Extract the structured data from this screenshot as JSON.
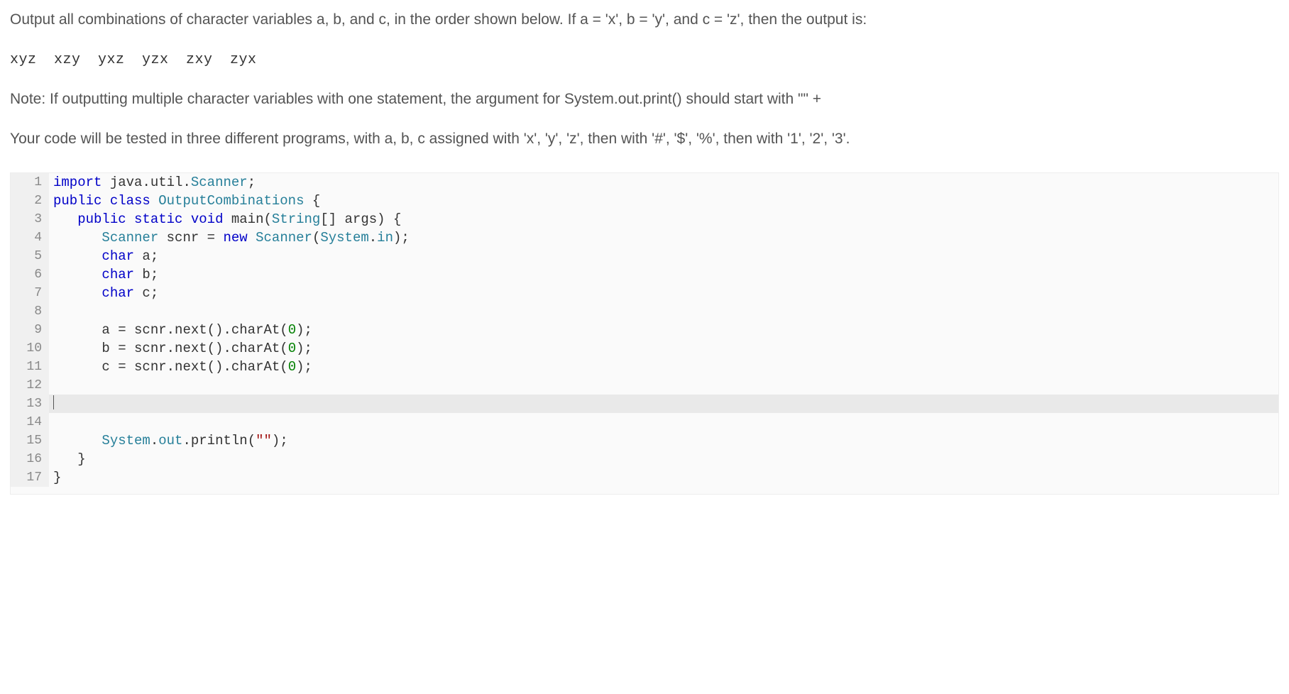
{
  "prompt": {
    "p1": "Output all combinations of character variables a, b, and c, in the order shown below. If a = 'x', b = 'y', and c = 'z', then the output is:",
    "sample": "xyz xzy yxz yzx zxy zyx",
    "p2": "Note: If outputting multiple character variables with one statement, the argument for System.out.print() should start with \"\" +",
    "p3": "Your code will be tested in three different programs, with a, b, c assigned with 'x', 'y', 'z', then with '#', '$', '%', then with '1', '2', '3'."
  },
  "code": {
    "lines": [
      {
        "n": 1,
        "tokens": [
          [
            "kw",
            "import"
          ],
          [
            "",
            " java"
          ],
          [
            "op",
            "."
          ],
          [
            "",
            "util"
          ],
          [
            "op",
            "."
          ],
          [
            "type",
            "Scanner"
          ],
          [
            "op",
            ";"
          ]
        ]
      },
      {
        "n": 2,
        "tokens": [
          [
            "kw",
            "public class"
          ],
          [
            "",
            " "
          ],
          [
            "type",
            "OutputCombinations"
          ],
          [
            "",
            " "
          ],
          [
            "op",
            "{"
          ]
        ]
      },
      {
        "n": 3,
        "tokens": [
          [
            "",
            "   "
          ],
          [
            "kw",
            "public static"
          ],
          [
            "",
            " "
          ],
          [
            "kw",
            "void"
          ],
          [
            "",
            " "
          ],
          [
            "",
            "main"
          ],
          [
            "op",
            "("
          ],
          [
            "type",
            "String"
          ],
          [
            "op",
            "[]"
          ],
          [
            "",
            " args"
          ],
          [
            "op",
            ")"
          ],
          [
            "",
            " "
          ],
          [
            "op",
            "{"
          ]
        ]
      },
      {
        "n": 4,
        "tokens": [
          [
            "",
            "      "
          ],
          [
            "type",
            "Scanner"
          ],
          [
            "",
            " scnr "
          ],
          [
            "op",
            "="
          ],
          [
            "",
            " "
          ],
          [
            "kw",
            "new"
          ],
          [
            "",
            " "
          ],
          [
            "type",
            "Scanner"
          ],
          [
            "op",
            "("
          ],
          [
            "type",
            "System"
          ],
          [
            "op",
            "."
          ],
          [
            "mem",
            "in"
          ],
          [
            "op",
            ")"
          ],
          [
            "op",
            ";"
          ]
        ]
      },
      {
        "n": 5,
        "tokens": [
          [
            "",
            "      "
          ],
          [
            "kw",
            "char"
          ],
          [
            "",
            " a"
          ],
          [
            "op",
            ";"
          ]
        ]
      },
      {
        "n": 6,
        "tokens": [
          [
            "",
            "      "
          ],
          [
            "kw",
            "char"
          ],
          [
            "",
            " b"
          ],
          [
            "op",
            ";"
          ]
        ]
      },
      {
        "n": 7,
        "tokens": [
          [
            "",
            "      "
          ],
          [
            "kw",
            "char"
          ],
          [
            "",
            " c"
          ],
          [
            "op",
            ";"
          ]
        ]
      },
      {
        "n": 8,
        "tokens": [
          [
            "",
            ""
          ]
        ]
      },
      {
        "n": 9,
        "tokens": [
          [
            "",
            "      a "
          ],
          [
            "op",
            "="
          ],
          [
            "",
            " scnr"
          ],
          [
            "op",
            "."
          ],
          [
            "",
            "next"
          ],
          [
            "op",
            "()."
          ],
          [
            "",
            "charAt"
          ],
          [
            "op",
            "("
          ],
          [
            "num",
            "0"
          ],
          [
            "op",
            ");"
          ]
        ]
      },
      {
        "n": 10,
        "tokens": [
          [
            "",
            "      b "
          ],
          [
            "op",
            "="
          ],
          [
            "",
            " scnr"
          ],
          [
            "op",
            "."
          ],
          [
            "",
            "next"
          ],
          [
            "op",
            "()."
          ],
          [
            "",
            "charAt"
          ],
          [
            "op",
            "("
          ],
          [
            "num",
            "0"
          ],
          [
            "op",
            ");"
          ]
        ]
      },
      {
        "n": 11,
        "tokens": [
          [
            "",
            "      c "
          ],
          [
            "op",
            "="
          ],
          [
            "",
            " scnr"
          ],
          [
            "op",
            "."
          ],
          [
            "",
            "next"
          ],
          [
            "op",
            "()."
          ],
          [
            "",
            "charAt"
          ],
          [
            "op",
            "("
          ],
          [
            "num",
            "0"
          ],
          [
            "op",
            ");"
          ]
        ]
      },
      {
        "n": 12,
        "tokens": [
          [
            "",
            ""
          ]
        ]
      },
      {
        "n": 13,
        "tokens": [
          [
            "",
            ""
          ]
        ],
        "current": true
      },
      {
        "n": 14,
        "tokens": [
          [
            "",
            ""
          ]
        ]
      },
      {
        "n": 15,
        "tokens": [
          [
            "",
            "      "
          ],
          [
            "type",
            "System"
          ],
          [
            "op",
            "."
          ],
          [
            "mem",
            "out"
          ],
          [
            "op",
            "."
          ],
          [
            "",
            "println"
          ],
          [
            "op",
            "("
          ],
          [
            "str",
            "\"\""
          ],
          [
            "op",
            ");"
          ]
        ]
      },
      {
        "n": 16,
        "tokens": [
          [
            "",
            "   "
          ],
          [
            "op",
            "}"
          ]
        ]
      },
      {
        "n": 17,
        "tokens": [
          [
            "op",
            "}"
          ]
        ]
      }
    ]
  }
}
